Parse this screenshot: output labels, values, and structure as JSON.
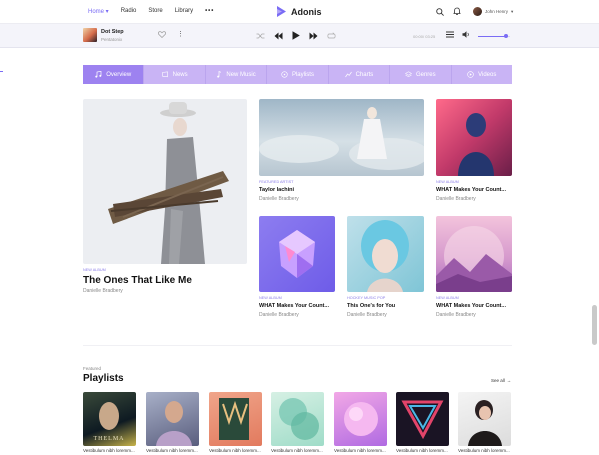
{
  "topnav": {
    "links": [
      {
        "label": "Home",
        "active": true
      },
      {
        "label": "Radio"
      },
      {
        "label": "Store"
      },
      {
        "label": "Library"
      }
    ],
    "more_label": "•••",
    "brand": "Adonis",
    "user_name": "John Henry"
  },
  "player": {
    "track": "Dot Step",
    "artist": "Pentatonix",
    "time": "00:00/ 03:25",
    "volume_level": 0.85
  },
  "tabs": [
    "Overview",
    "News",
    "New Music",
    "Playlists",
    "Charts",
    "Genres",
    "Videos"
  ],
  "featured_main": {
    "label": "New Album",
    "title": "The Ones That Like Me",
    "artist": "Danielle Bradbery"
  },
  "cards": [
    {
      "label": "Featured Artist",
      "title": "Taylor lachini",
      "artist": "Danielle Bradbery"
    },
    {
      "label": "New Album",
      "title": "WHAT Makes Your Count...",
      "artist": "Danielle Bradbery"
    },
    {
      "label": "New Album",
      "title": "WHAT Makes Your Count...",
      "artist": "Danielle Bradbery"
    },
    {
      "label": "Hockey Music Pop",
      "title": "This One's for You",
      "artist": "Danielle Bradbery"
    },
    {
      "label": "New Album",
      "title": "WHAT Makes Your Count...",
      "artist": "Danielle Bradbery"
    }
  ],
  "playlists": {
    "eyebrow": "Featured",
    "title": "Playlists",
    "see_all": "See all",
    "cover_text": "THELMA",
    "items": [
      {
        "caption": "Vestibulum nibh loremm..."
      },
      {
        "caption": "Vestibulum nibh loremm..."
      },
      {
        "caption": "Vestibulum nibh loremm..."
      },
      {
        "caption": "Vestibulum nibh loremm..."
      },
      {
        "caption": "Vestibulum nibh loremm..."
      },
      {
        "caption": "Vestibulum nibh loremm..."
      },
      {
        "caption": "Vestibulum nibh loremm..."
      }
    ]
  },
  "colors": {
    "accent": "#7a6cf5",
    "tab_bg": "#c9b4f5",
    "tab_active": "#9d82f0"
  }
}
